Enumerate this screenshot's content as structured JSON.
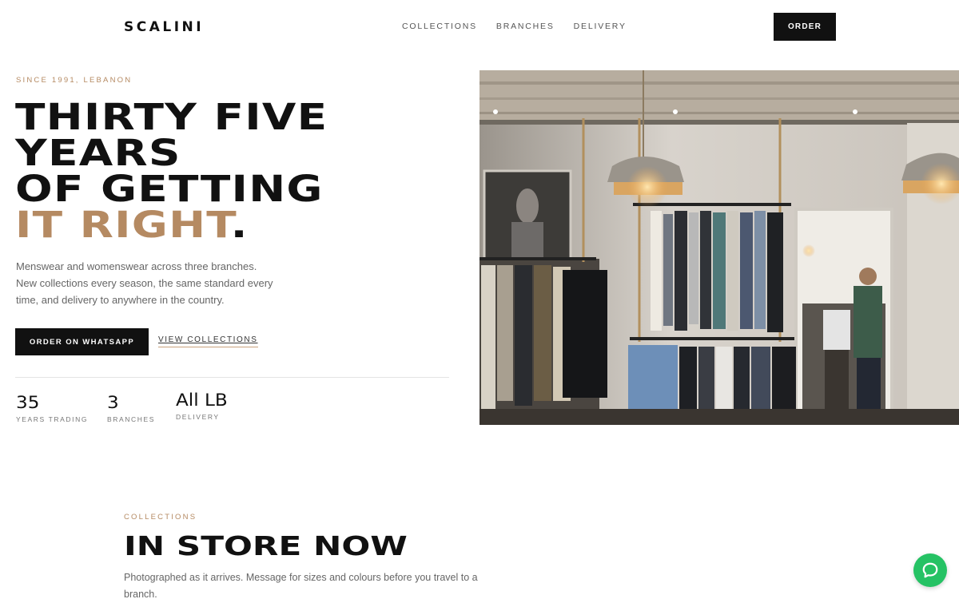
{
  "header": {
    "logo": "SCALINI",
    "nav": [
      "COLLECTIONS",
      "BRANCHES",
      "DELIVERY"
    ],
    "order_label": "ORDER"
  },
  "hero": {
    "eyebrow": "SINCE 1991, LEBANON",
    "title_lines": [
      "THIRTY FIVE",
      "YEARS",
      "OF GETTING"
    ],
    "title_accent": "IT RIGHT",
    "title_dot": ".",
    "description": "Menswear and womenswear across three branches. New collections every season, the same standard every time, and delivery to anywhere in the country.",
    "primary_cta": "ORDER ON WHATSAPP",
    "secondary_cta": "VIEW COLLECTIONS",
    "stats": [
      {
        "value": "35",
        "label": "YEARS TRADING"
      },
      {
        "value": "3",
        "label": "BRANCHES"
      },
      {
        "value": "All LB",
        "label": "DELIVERY"
      }
    ]
  },
  "collections": {
    "eyebrow": "COLLECTIONS",
    "title": "IN STORE NOW",
    "description": "Photographed as it arrives. Message for sizes and colours before you travel to a branch."
  },
  "colors": {
    "accent": "#b58a62",
    "dark": "#111111",
    "chat": "#25c264"
  },
  "icons": {
    "chat": "chat-bubble-icon"
  }
}
